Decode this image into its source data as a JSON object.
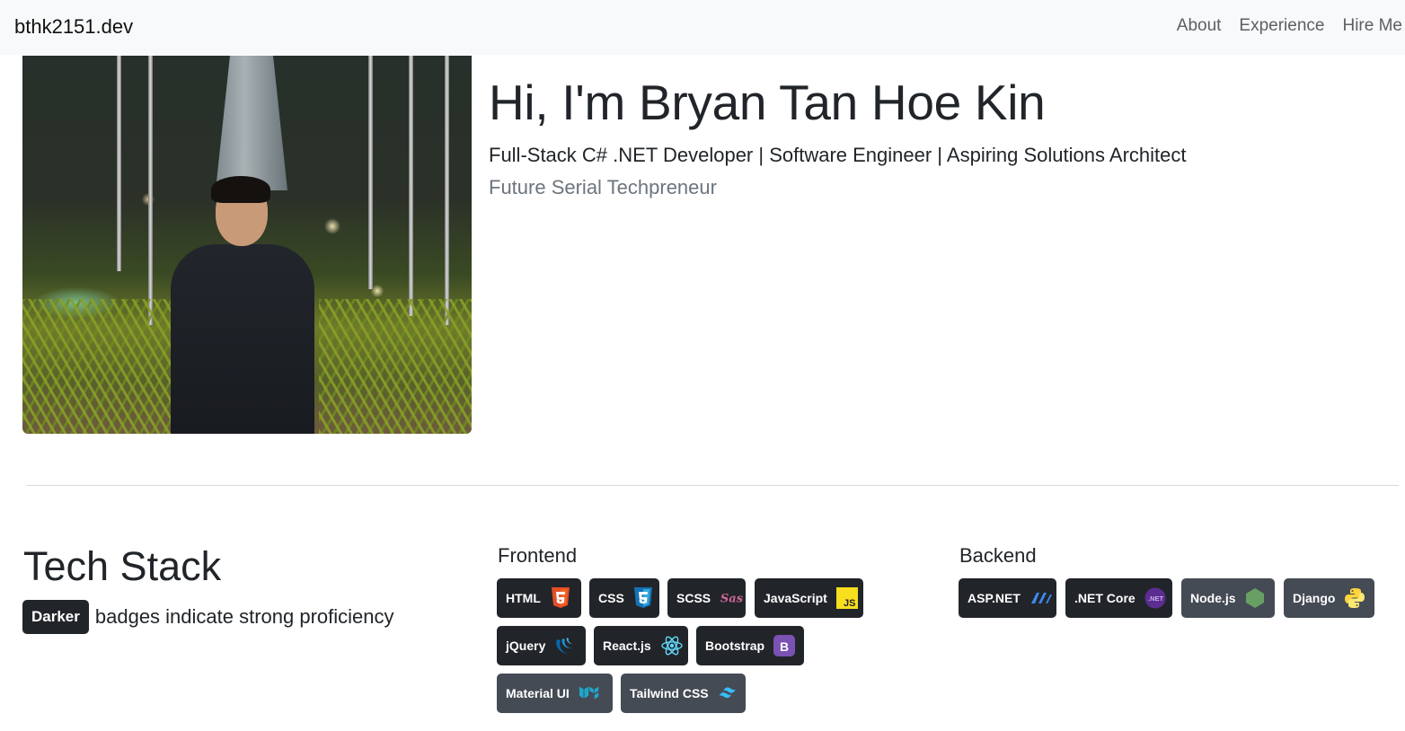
{
  "navbar": {
    "brand": "bthk2151.dev",
    "links": [
      "About",
      "Experience",
      "Hire Me"
    ]
  },
  "hero": {
    "title": "Hi, I'm Bryan Tan Hoe Kin",
    "subtitle": "Full-Stack C# .NET Developer | Software Engineer | Aspiring Solutions Architect",
    "tagline": "Future Serial Techpreneur"
  },
  "tech_stack": {
    "title": "Tech Stack",
    "legend_badge": "Darker",
    "legend_text": "badges indicate strong proficiency",
    "frontend": {
      "title": "Frontend",
      "badges": [
        {
          "label": "HTML",
          "icon": "html5-icon",
          "proficiency": "strong"
        },
        {
          "label": "CSS",
          "icon": "css3-icon",
          "proficiency": "strong"
        },
        {
          "label": "SCSS",
          "icon": "sass-icon",
          "proficiency": "strong"
        },
        {
          "label": "JavaScript",
          "icon": "javascript-icon",
          "proficiency": "strong"
        },
        {
          "label": "jQuery",
          "icon": "jquery-icon",
          "proficiency": "strong"
        },
        {
          "label": "React.js",
          "icon": "react-icon",
          "proficiency": "strong"
        },
        {
          "label": "Bootstrap",
          "icon": "bootstrap-icon",
          "proficiency": "strong"
        },
        {
          "label": "Material UI",
          "icon": "material-ui-icon",
          "proficiency": "moderate"
        },
        {
          "label": "Tailwind CSS",
          "icon": "tailwind-icon",
          "proficiency": "moderate"
        }
      ]
    },
    "backend": {
      "title": "Backend",
      "badges": [
        {
          "label": "ASP.NET",
          "icon": "aspnet-icon",
          "proficiency": "strong"
        },
        {
          "label": ".NET Core",
          "icon": "dotnet-icon",
          "proficiency": "strong"
        },
        {
          "label": "Node.js",
          "icon": "nodejs-icon",
          "proficiency": "moderate"
        },
        {
          "label": "Django",
          "icon": "python-icon",
          "proficiency": "moderate"
        }
      ]
    }
  },
  "colors": {
    "navbar_bg": "#f8f9fa",
    "badge_strong": "#212529",
    "badge_moderate": "#454b55",
    "muted_text": "#6c757d"
  }
}
